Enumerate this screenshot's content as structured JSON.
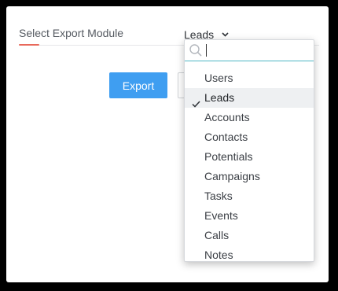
{
  "form": {
    "label": "Select Export Module",
    "selected_value": "Leads",
    "export_label": "Export"
  },
  "dropdown": {
    "search_value": "",
    "options": [
      {
        "label": "Users",
        "selected": false
      },
      {
        "label": "Leads",
        "selected": true
      },
      {
        "label": "Accounts",
        "selected": false
      },
      {
        "label": "Contacts",
        "selected": false
      },
      {
        "label": "Potentials",
        "selected": false
      },
      {
        "label": "Campaigns",
        "selected": false
      },
      {
        "label": "Tasks",
        "selected": false
      },
      {
        "label": "Events",
        "selected": false
      },
      {
        "label": "Calls",
        "selected": false
      },
      {
        "label": "Notes",
        "selected": false
      }
    ]
  },
  "icons": {
    "search": "search-icon",
    "check": "check-icon",
    "chevron": "chevron-down-icon"
  },
  "colors": {
    "primary_button": "#3f9ef1",
    "label_underline": "#e8695b",
    "search_focus_border": "#4fb7c4",
    "selected_option_bg": "#eef0f2"
  }
}
